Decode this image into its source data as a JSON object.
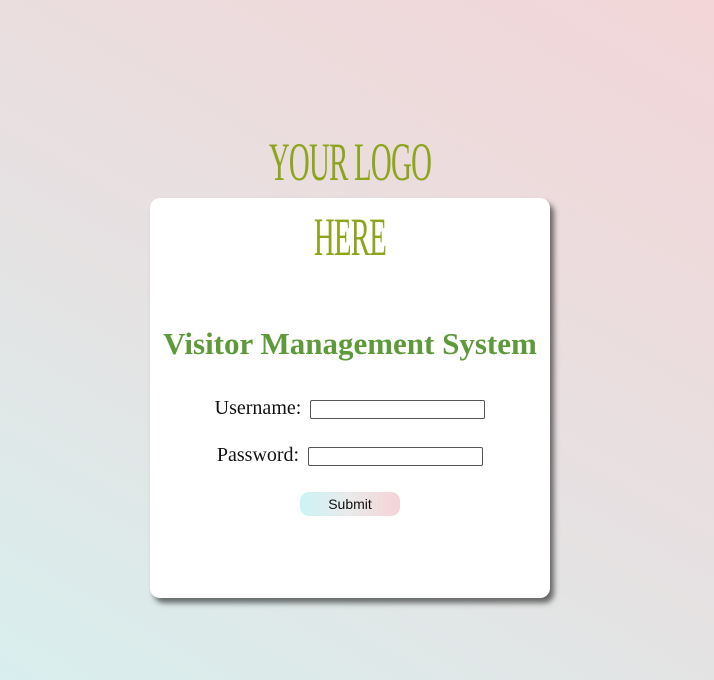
{
  "logo": {
    "line1": "YOUR LOGO",
    "line2": "HERE",
    "color": "#8ca51a"
  },
  "form": {
    "title": "Visitor Management System",
    "username_label": "Username:",
    "username_value": "",
    "password_label": "Password:",
    "password_value": "",
    "submit_label": "Submit"
  },
  "colors": {
    "title": "#5e9a3a",
    "background_left": "#d8efee",
    "background_right": "#f3d6d8"
  }
}
